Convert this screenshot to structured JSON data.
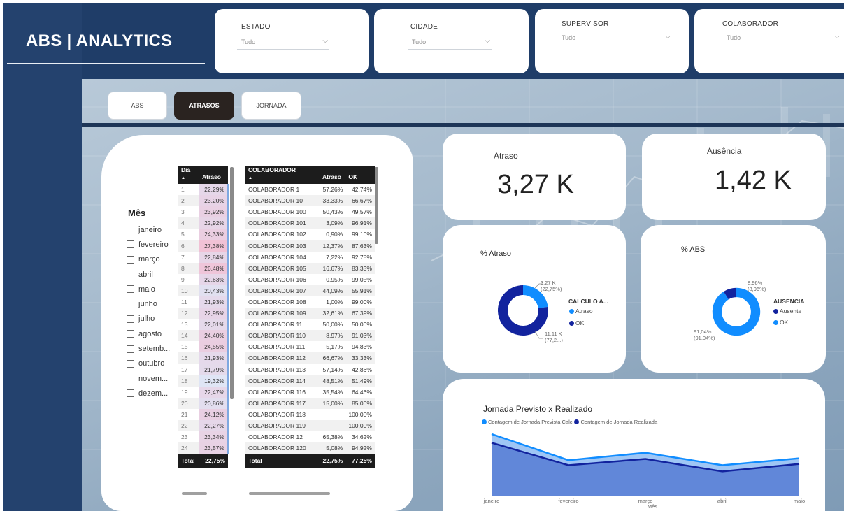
{
  "app": {
    "title": "ABS | ANALYTICS"
  },
  "filters": [
    {
      "label": "ESTADO",
      "value": "Tudo"
    },
    {
      "label": "CIDADE",
      "value": "Tudo"
    },
    {
      "label": "SUPERVISOR",
      "value": "Tudo"
    },
    {
      "label": "COLABORADOR",
      "value": "Tudo"
    }
  ],
  "nav": {
    "abs": "ABS",
    "atrasos": "ATRASOS",
    "jornada": "JORNADA"
  },
  "months": {
    "title": "Mês",
    "items": [
      "janeiro",
      "fevereiro",
      "março",
      "abril",
      "maio",
      "junho",
      "julho",
      "agosto",
      "setemb...",
      "outubro",
      "novem...",
      "dezem..."
    ]
  },
  "day_table": {
    "headers": [
      "Dia",
      "Atraso"
    ],
    "rows": [
      [
        "1",
        "22,29%"
      ],
      [
        "2",
        "23,20%"
      ],
      [
        "3",
        "23,92%"
      ],
      [
        "4",
        "22,92%"
      ],
      [
        "5",
        "24,33%"
      ],
      [
        "6",
        "27,38%"
      ],
      [
        "7",
        "22,84%"
      ],
      [
        "8",
        "26,48%"
      ],
      [
        "9",
        "22,63%"
      ],
      [
        "10",
        "20,43%"
      ],
      [
        "11",
        "21,93%"
      ],
      [
        "12",
        "22,95%"
      ],
      [
        "13",
        "22,01%"
      ],
      [
        "14",
        "24,40%"
      ],
      [
        "15",
        "24,55%"
      ],
      [
        "16",
        "21,93%"
      ],
      [
        "17",
        "21,79%"
      ],
      [
        "18",
        "19,32%"
      ],
      [
        "19",
        "22,47%"
      ],
      [
        "20",
        "20,86%"
      ],
      [
        "21",
        "24,12%"
      ],
      [
        "22",
        "22,27%"
      ],
      [
        "23",
        "23,34%"
      ],
      [
        "24",
        "23,57%"
      ]
    ],
    "total_label": "Total",
    "total_value": "22,75%"
  },
  "collab_table": {
    "headers": [
      "COLABORADOR",
      "Atraso",
      "OK"
    ],
    "rows": [
      [
        "COLABORADOR 1",
        "57,26%",
        "42,74%"
      ],
      [
        "COLABORADOR 10",
        "33,33%",
        "66,67%"
      ],
      [
        "COLABORADOR 100",
        "50,43%",
        "49,57%"
      ],
      [
        "COLABORADOR 101",
        "3,09%",
        "96,91%"
      ],
      [
        "COLABORADOR 102",
        "0,90%",
        "99,10%"
      ],
      [
        "COLABORADOR 103",
        "12,37%",
        "87,63%"
      ],
      [
        "COLABORADOR 104",
        "7,22%",
        "92,78%"
      ],
      [
        "COLABORADOR 105",
        "16,67%",
        "83,33%"
      ],
      [
        "COLABORADOR 106",
        "0,95%",
        "99,05%"
      ],
      [
        "COLABORADOR 107",
        "44,09%",
        "55,91%"
      ],
      [
        "COLABORADOR 108",
        "1,00%",
        "99,00%"
      ],
      [
        "COLABORADOR 109",
        "32,61%",
        "67,39%"
      ],
      [
        "COLABORADOR 11",
        "50,00%",
        "50,00%"
      ],
      [
        "COLABORADOR 110",
        "8,97%",
        "91,03%"
      ],
      [
        "COLABORADOR 111",
        "5,17%",
        "94,83%"
      ],
      [
        "COLABORADOR 112",
        "66,67%",
        "33,33%"
      ],
      [
        "COLABORADOR 113",
        "57,14%",
        "42,86%"
      ],
      [
        "COLABORADOR 114",
        "48,51%",
        "51,49%"
      ],
      [
        "COLABORADOR 116",
        "35,54%",
        "64,46%"
      ],
      [
        "COLABORADOR 117",
        "15,00%",
        "85,00%"
      ],
      [
        "COLABORADOR 118",
        "",
        "100,00%"
      ],
      [
        "COLABORADOR 119",
        "",
        "100,00%"
      ],
      [
        "COLABORADOR 12",
        "65,38%",
        "34,62%"
      ],
      [
        "COLABORADOR 120",
        "5,08%",
        "94,92%"
      ]
    ],
    "total_label": "Total",
    "total_atraso": "22,75%",
    "total_ok": "77,25%"
  },
  "kpis": {
    "atraso": {
      "title": "Atraso",
      "value": "3,27 K"
    },
    "ausencia": {
      "title": "Ausência",
      "value": "1,42 K"
    }
  },
  "pie_atraso": {
    "title": "% Atraso",
    "legend_title": "CALCULO A...",
    "legend": [
      "Atraso",
      "OK"
    ],
    "label_atraso": [
      "3,27 K",
      "(22,75%)"
    ],
    "label_ok": [
      "11,11 K",
      "(77,2...)"
    ],
    "colors": {
      "Atraso": "#118dff",
      "OK": "#12239e"
    }
  },
  "pie_abs": {
    "title": "% ABS",
    "legend_title": "AUSENCIA",
    "legend": [
      "Ausente",
      "OK"
    ],
    "label_ausente": [
      "8,96%",
      "(8,96%)"
    ],
    "label_ok": [
      "91,04%",
      "(91,04%)"
    ],
    "colors": {
      "Ausente": "#12239e",
      "OK": "#118dff"
    }
  },
  "chart_data": [
    {
      "type": "pie",
      "title": "% Atraso",
      "categories": [
        "Atraso",
        "OK"
      ],
      "values": [
        3.27,
        11.11
      ],
      "percent": [
        22.75,
        77.25
      ],
      "colors": [
        "#118dff",
        "#12239e"
      ]
    },
    {
      "type": "pie",
      "title": "% ABS",
      "categories": [
        "Ausente",
        "OK"
      ],
      "values": [
        8.96,
        91.04
      ],
      "colors": [
        "#12239e",
        "#118dff"
      ]
    },
    {
      "type": "area",
      "title": "Jornada Previsto x Realizado",
      "xlabel": "Mês",
      "categories": [
        "janeiro",
        "fevereiro",
        "março",
        "abril",
        "maio"
      ],
      "series": [
        {
          "name": "Contagem de Jornada Prevista Calc",
          "values": [
            100,
            58,
            70,
            50,
            61
          ],
          "color": "#118dff"
        },
        {
          "name": "Contagem de Jornada Realizada",
          "values": [
            86,
            50,
            60,
            40,
            52
          ],
          "color": "#12239e"
        }
      ],
      "ylim": [
        0,
        110
      ],
      "grid": false,
      "legend": "top-left"
    }
  ]
}
